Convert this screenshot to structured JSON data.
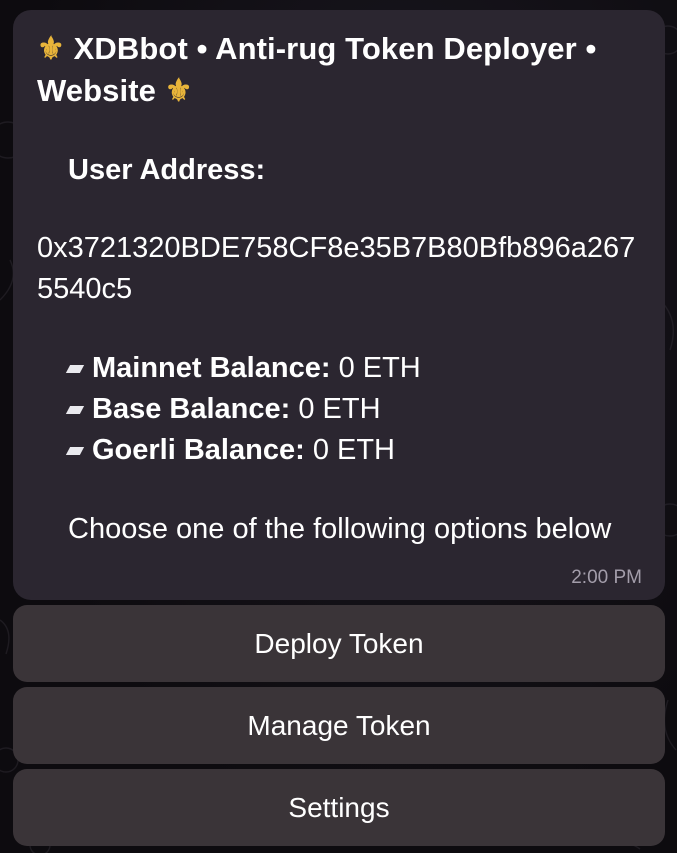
{
  "message": {
    "title_line1": "XDBbot • Anti-rug Token Deployer •",
    "title_line2": "Website",
    "user_address_label": "User Address:",
    "address": "0x3721320BDE758CF8e35B7B80Bfb896a2675540c5",
    "balances": [
      {
        "label": "Mainnet Balance:",
        "value": "0 ETH"
      },
      {
        "label": "Base Balance:",
        "value": "0 ETH"
      },
      {
        "label": "Goerli Balance:",
        "value": "0 ETH"
      }
    ],
    "prompt": "Choose one of the following options below",
    "time": "2:00 PM"
  },
  "keyboard": [
    {
      "label": "Deploy Token"
    },
    {
      "label": "Manage Token"
    },
    {
      "label": "Settings"
    }
  ],
  "icons": {
    "title_decoration": "fleur-de-lis-icon",
    "balance_bullet": "parallelogram-bullet-icon"
  },
  "colors": {
    "bubble": "#2b2630",
    "button": "#3a3438",
    "fleur": "#e8b43a",
    "timestamp": "#a39daa"
  }
}
